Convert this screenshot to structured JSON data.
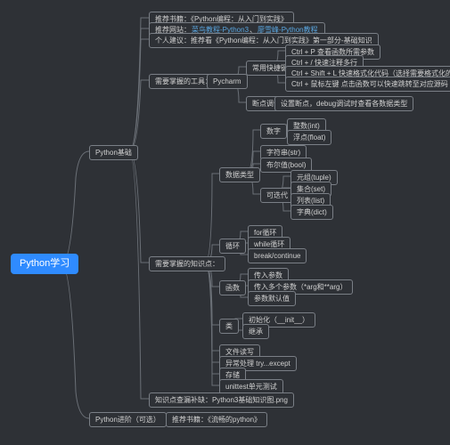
{
  "root": "Python学习",
  "l1": {
    "base": "Python基础",
    "adv": "Python进阶（可选）"
  },
  "rec": {
    "book": "推荐书籍：《Python编程：从入门到实践》",
    "site_prefix": "推荐网站：",
    "site1": "菜鸟教程-Python3",
    "site_sep": "、",
    "site2": "廖雪峰-Python教程",
    "tip": "个人建议：推荐看《Python编程：从入门到实践》第一部分-基础知识"
  },
  "tools": {
    "label": "需要掌握的工具：",
    "name": "Pycharm",
    "shortcut": {
      "label": "常用快捷键",
      "a": "Ctrl + P 查看函数所需参数",
      "b": "Ctrl + / 快速注释多行",
      "c": "Ctrl + Shift + L 快速格式化代码（选择需要格式化的代码再使用该快捷键）",
      "d": "Ctrl + 鼠标左键 点击函数可以快速跳转至对应源码"
    },
    "debug": {
      "label": "断点调试",
      "text": "设置断点，debug调试时查看各数据类型"
    }
  },
  "know": {
    "label": "需要掌握的知识点：",
    "dtype": {
      "label": "数据类型",
      "num": {
        "label": "数字",
        "int": "整数(int)",
        "float": "浮点(float)"
      },
      "str": "字符串(str)",
      "bool": "布尔值(bool)",
      "iter": {
        "label": "可迭代",
        "tuple": "元组(tuple)",
        "set": "集合(set)",
        "list": "列表(list)",
        "dict": "字典(dict)"
      }
    },
    "loop": {
      "label": "循环",
      "for": "for循环",
      "while": "while循环",
      "bc": "break/continue"
    },
    "func": {
      "label": "函数",
      "a": "传入参数",
      "b": "传入多个参数（*arg和**arg）",
      "c": "参数默认值"
    },
    "cls": {
      "label": "类",
      "a": "初始化（__init__）",
      "b": "继承"
    },
    "file": "文件读写",
    "exc": "异常处理 try...except",
    "save": "存储",
    "ut": "unittest单元测试"
  },
  "extra": "知识点查漏补缺：Python3基础知识图.png",
  "adv_book": "推荐书籍：《流畅的python》"
}
